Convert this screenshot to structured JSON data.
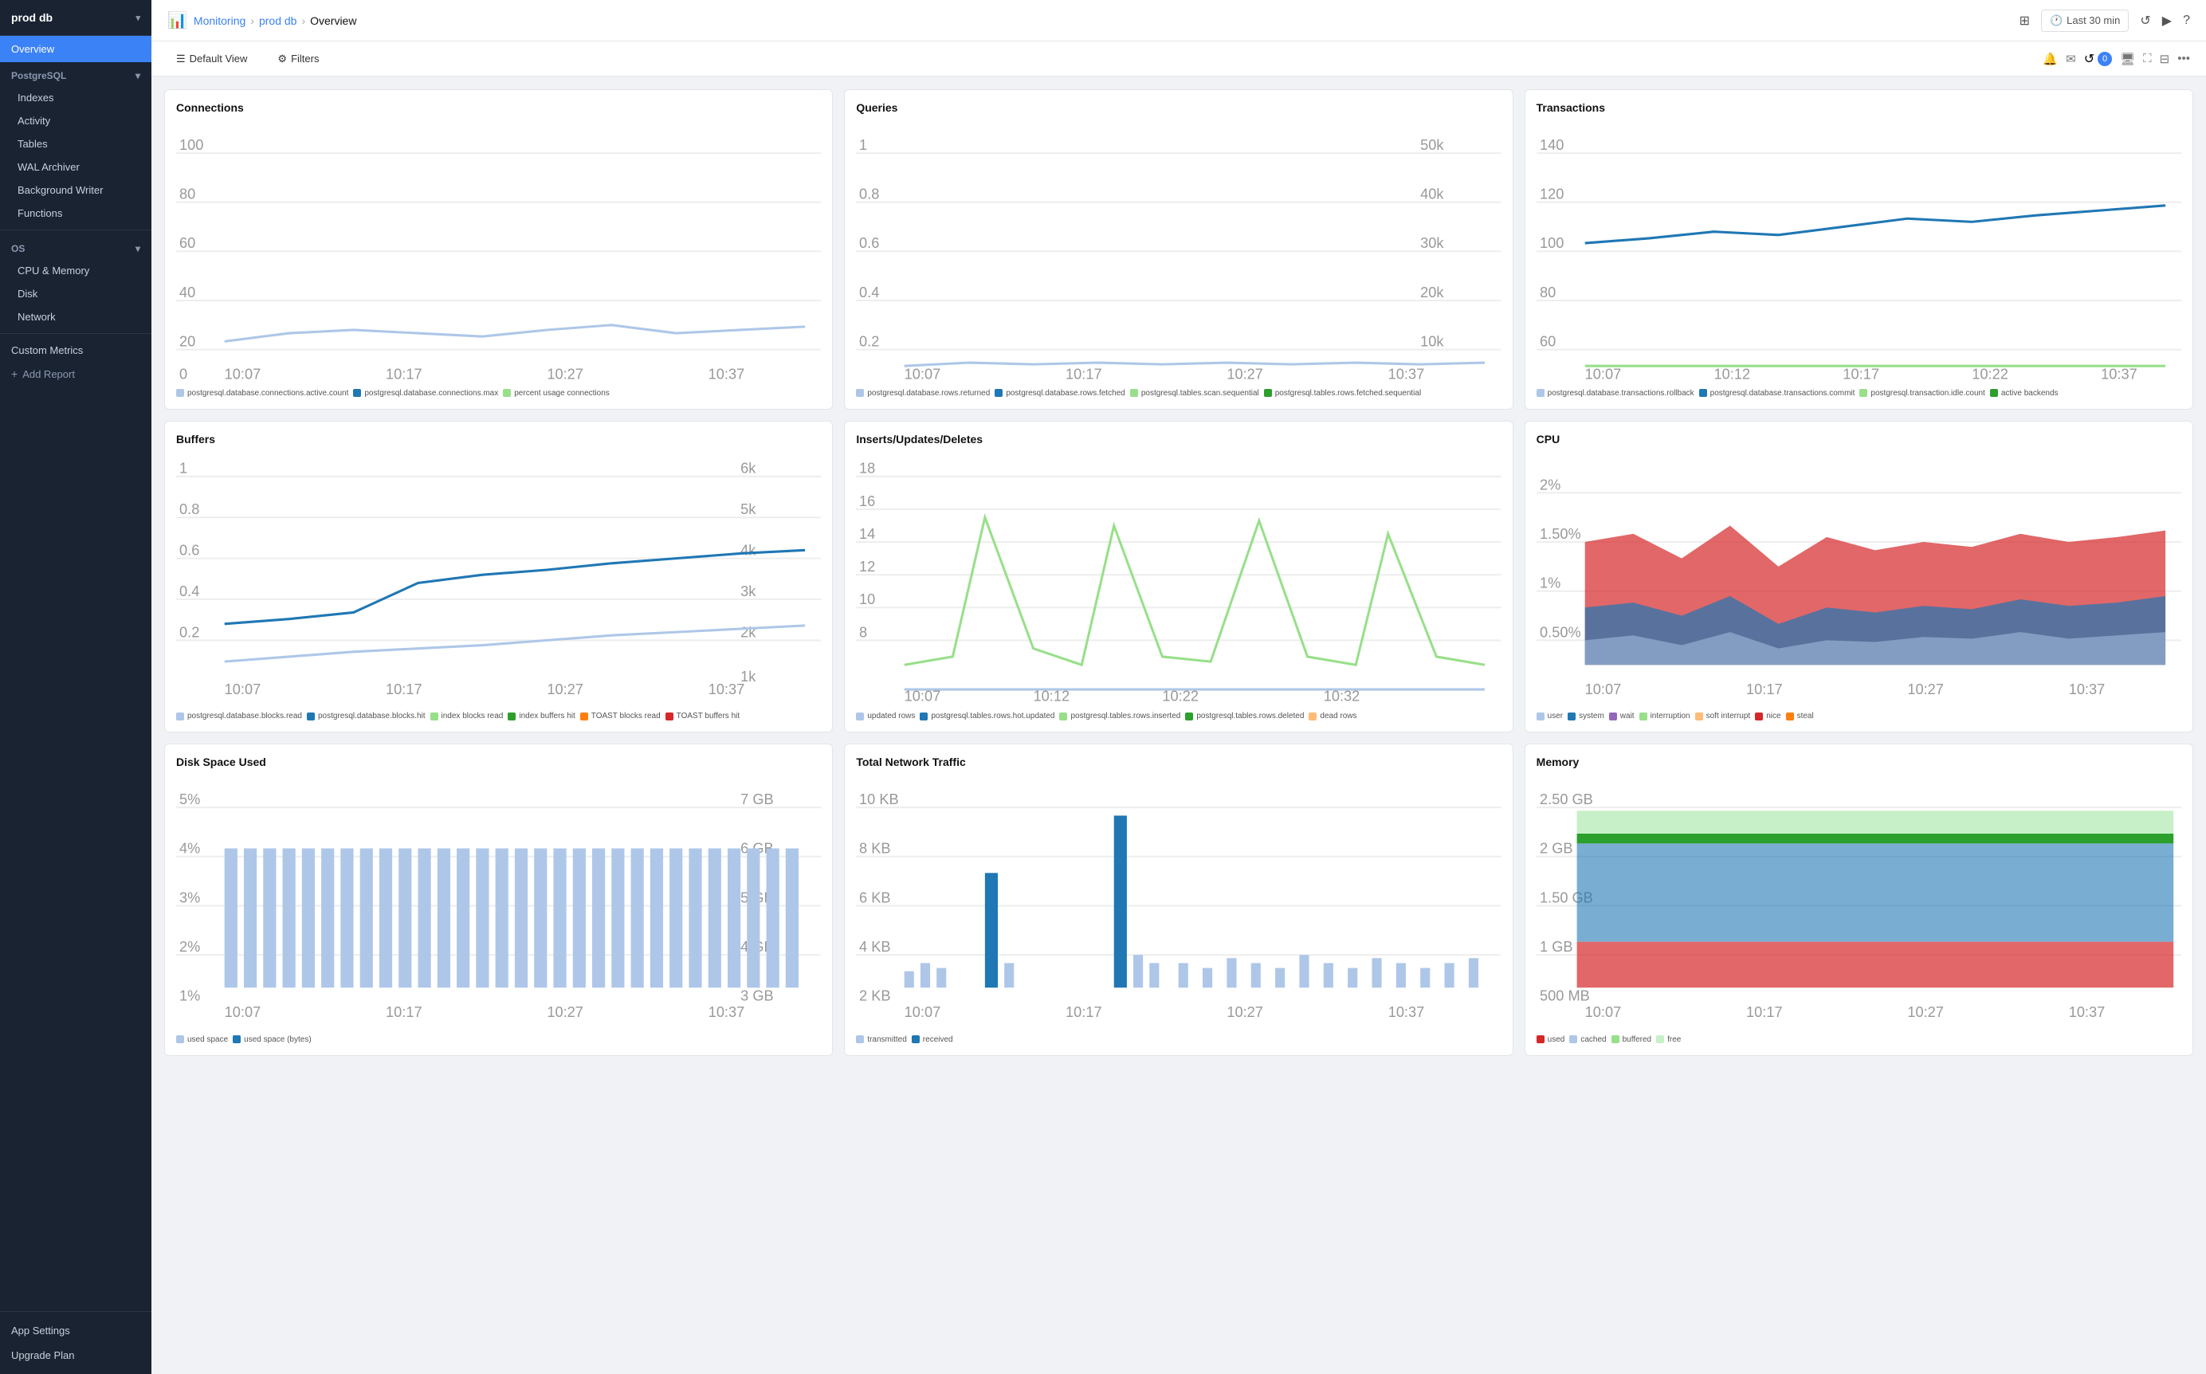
{
  "app": {
    "db_name": "prod db",
    "breadcrumb": {
      "monitoring": "Monitoring",
      "db": "prod db",
      "current": "Overview"
    }
  },
  "topbar": {
    "time_label": "Last 30 min",
    "grid_icon": "⊞",
    "clock_icon": "🕐",
    "refresh_icon": "↺",
    "play_icon": "▶",
    "help_icon": "?"
  },
  "toolbar": {
    "default_view_label": "Default View",
    "filters_label": "Filters",
    "bell_icon": "🔔",
    "mail_icon": "✉",
    "notif_count": "0",
    "monitor_icon": "🖥",
    "expand_icon": "⛶",
    "layout_icon": "⊟",
    "more_icon": "…"
  },
  "sidebar": {
    "db_name": "prod db",
    "active_item": "Overview",
    "postgresql_label": "PostgreSQL",
    "items_postgresql": [
      "Indexes",
      "Activity",
      "Tables",
      "WAL Archiver",
      "Background Writer",
      "Functions"
    ],
    "os_label": "OS",
    "items_os": [
      "CPU & Memory",
      "Disk",
      "Network"
    ],
    "custom_metrics": "Custom Metrics",
    "add_report": "Add Report",
    "app_settings": "App Settings",
    "upgrade_plan": "Upgrade Plan"
  },
  "charts": {
    "connections": {
      "title": "Connections",
      "legend": [
        {
          "color": "#aec7e8",
          "label": "postgresql.database.connections.active.count"
        },
        {
          "color": "#1f77b4",
          "label": "postgresql.database.connections.max"
        },
        {
          "color": "#98df8a",
          "label": "percent usage connections"
        }
      ]
    },
    "queries": {
      "title": "Queries",
      "legend": [
        {
          "color": "#aec7e8",
          "label": "postgresql.database.rows.returned"
        },
        {
          "color": "#1f77b4",
          "label": "postgresql.database.rows.fetched"
        },
        {
          "color": "#98df8a",
          "label": "postgresql.tables.scan.sequential"
        },
        {
          "color": "#2ca02c",
          "label": "postgresql.tables.rows.fetched.sequential"
        }
      ]
    },
    "transactions": {
      "title": "Transactions",
      "legend": [
        {
          "color": "#aec7e8",
          "label": "postgresql.database.transactions.rollback"
        },
        {
          "color": "#1f77b4",
          "label": "postgresql.database.transactions.commit"
        },
        {
          "color": "#98df8a",
          "label": "postgresql.transaction.idle.count"
        },
        {
          "color": "#2ca02c",
          "label": "active backends"
        }
      ]
    },
    "buffers": {
      "title": "Buffers",
      "legend": [
        {
          "color": "#aec7e8",
          "label": "postgresql.database.blocks.read"
        },
        {
          "color": "#1f77b4",
          "label": "postgresql.database.blocks.hit"
        },
        {
          "color": "#98df8a",
          "label": "index blocks read"
        },
        {
          "color": "#2ca02c",
          "label": "index buffers hit"
        },
        {
          "color": "#d62728",
          "label": "TOAST blocks read"
        },
        {
          "color": "#ff7f0e",
          "label": "TOAST buffers hit"
        }
      ]
    },
    "inserts": {
      "title": "Inserts/Updates/Deletes",
      "legend": [
        {
          "color": "#aec7e8",
          "label": "updated rows"
        },
        {
          "color": "#1f77b4",
          "label": "postgresql.tables.rows.hot.updated"
        },
        {
          "color": "#98df8a",
          "label": "postgresql.tables.rows.inserted"
        },
        {
          "color": "#2ca02c",
          "label": "postgresql.tables.rows.deleted"
        },
        {
          "color": "#ffbb78",
          "label": "dead rows"
        }
      ]
    },
    "cpu": {
      "title": "CPU",
      "legend": [
        {
          "color": "#aec7e8",
          "label": "user"
        },
        {
          "color": "#1f77b4",
          "label": "system"
        },
        {
          "color": "#9467bd",
          "label": "wait"
        },
        {
          "color": "#98df8a",
          "label": "interruption"
        },
        {
          "color": "#ffbb78",
          "label": "soft interrupt"
        },
        {
          "color": "#d62728",
          "label": "nice"
        },
        {
          "color": "#ff7f0e",
          "label": "steal"
        }
      ]
    },
    "disk_space": {
      "title": "Disk Space Used",
      "legend": [
        {
          "color": "#aec7e8",
          "label": "used space"
        },
        {
          "color": "#1f77b4",
          "label": "used space (bytes)"
        }
      ]
    },
    "network": {
      "title": "Total Network Traffic",
      "legend": [
        {
          "color": "#aec7e8",
          "label": "transmitted"
        },
        {
          "color": "#1f77b4",
          "label": "received"
        }
      ]
    },
    "memory": {
      "title": "Memory",
      "legend": [
        {
          "color": "#d62728",
          "label": "used"
        },
        {
          "color": "#aec7e8",
          "label": "cached"
        },
        {
          "color": "#98df8a",
          "label": "buffered"
        },
        {
          "color": "#c8f0c8",
          "label": "free"
        }
      ]
    }
  },
  "time_labels": [
    "10:07",
    "10:17",
    "10:27",
    "10:37"
  ]
}
